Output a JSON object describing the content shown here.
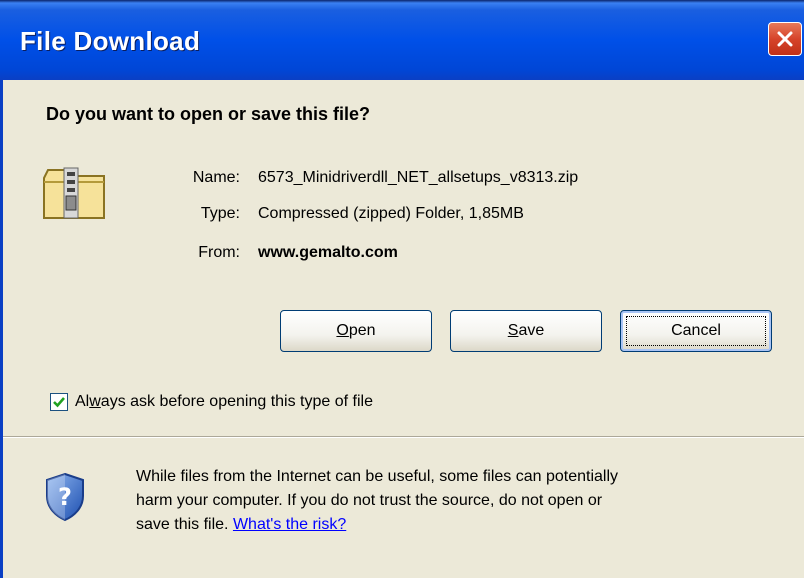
{
  "window": {
    "title": "File Download"
  },
  "dialog": {
    "question": "Do you want to open or save this file?",
    "file": {
      "name_label": "Name:",
      "name_value": "6573_Minidriverdll_NET_allsetups_v8313.zip",
      "type_label": "Type:",
      "type_value": "Compressed (zipped) Folder, 1,85MB",
      "from_label": "From:",
      "from_value": "www.gemalto.com"
    },
    "buttons": {
      "open_mnemonic": "O",
      "open_rest": "pen",
      "save_mnemonic": "S",
      "save_rest": "ave",
      "cancel": "Cancel"
    },
    "checkbox": {
      "checked": true,
      "label_pre": "Al",
      "label_mnemonic": "w",
      "label_post": "ays ask before opening this type of file"
    },
    "warning": {
      "line1": "While files from the Internet can be useful, some files can potentially",
      "line2": "harm your computer. If you do not trust the source, do not open or",
      "line3_pre": "save this file. ",
      "link": "What's the risk?"
    }
  },
  "icons": {
    "close": "close-icon",
    "file": "zip-folder-icon",
    "checkbox": "checkmark-icon",
    "warning": "security-shield-icon"
  },
  "colors": {
    "titlebar": "#0050e8",
    "dialog_bg": "#ece9d8",
    "close_button": "#d6442a",
    "link": "#0000ff"
  }
}
